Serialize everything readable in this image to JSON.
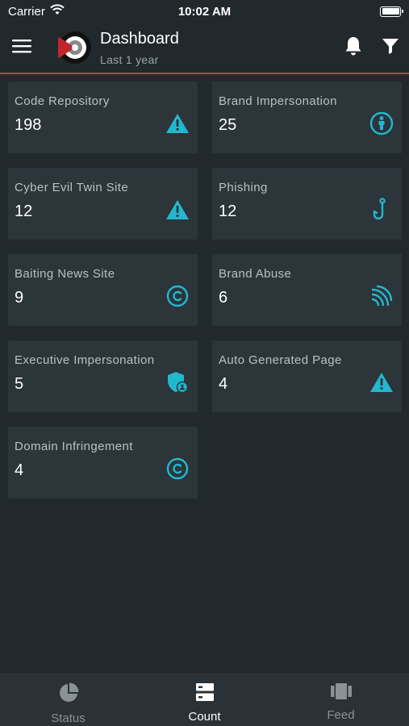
{
  "status_bar": {
    "carrier": "Carrier",
    "time": "10:02 AM"
  },
  "header": {
    "title": "Dashboard",
    "subtitle": "Last 1 year"
  },
  "cards": [
    {
      "label": "Code Repository",
      "count": "198",
      "icon": "warning-icon"
    },
    {
      "label": "Brand Impersonation",
      "count": "25",
      "icon": "person-info-icon"
    },
    {
      "label": "Cyber Evil Twin Site",
      "count": "12",
      "icon": "warning-icon"
    },
    {
      "label": "Phishing",
      "count": "12",
      "icon": "fishhook-icon"
    },
    {
      "label": "Baiting News Site",
      "count": "9",
      "icon": "copyright-icon"
    },
    {
      "label": "Brand Abuse",
      "count": "6",
      "icon": "signal-waves-icon"
    },
    {
      "label": "Executive Impersonation",
      "count": "5",
      "icon": "shield-user-icon"
    },
    {
      "label": "Auto Generated Page",
      "count": "4",
      "icon": "warning-icon"
    },
    {
      "label": "Domain Infringement",
      "count": "4",
      "icon": "copyright-icon"
    }
  ],
  "tabs": [
    {
      "label": "Status",
      "icon": "pie-chart-icon",
      "active": false
    },
    {
      "label": "Count",
      "icon": "server-icon",
      "active": true
    },
    {
      "label": "Feed",
      "icon": "feed-icon",
      "active": false
    }
  ],
  "colors": {
    "accent": "#22b8cf",
    "header_border": "#b4474b",
    "background": "#22292d",
    "card": "#2c353a"
  }
}
